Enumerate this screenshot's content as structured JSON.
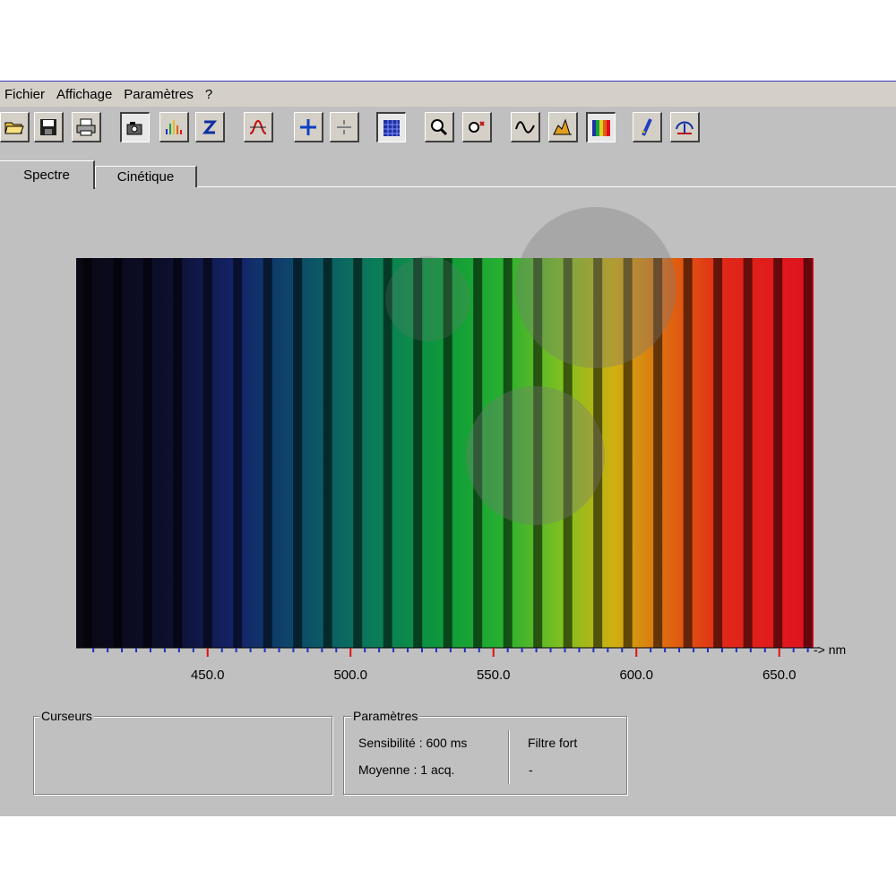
{
  "menu": {
    "items": [
      "Fichier",
      "Affichage",
      "Paramètres",
      "?"
    ]
  },
  "toolbar": {
    "buttons": [
      {
        "icon": "open-folder-icon",
        "pressed": false
      },
      {
        "icon": "save-icon",
        "pressed": false
      },
      {
        "icon": "print-icon",
        "pressed": false
      },
      {
        "icon": "camera-icon",
        "pressed": true
      },
      {
        "icon": "spectrum-bars-icon",
        "pressed": false
      },
      {
        "icon": "z-icon",
        "pressed": false
      },
      {
        "icon": "curve-fit-icon",
        "pressed": false
      },
      {
        "icon": "cursor-cross-icon",
        "pressed": false
      },
      {
        "icon": "divide-icon",
        "pressed": false
      },
      {
        "icon": "grid-icon",
        "pressed": true
      },
      {
        "icon": "zoom-icon",
        "pressed": false
      },
      {
        "icon": "zoom-reset-icon",
        "pressed": false
      },
      {
        "icon": "wave-icon",
        "pressed": false
      },
      {
        "icon": "spectrum-chart-icon",
        "pressed": false
      },
      {
        "icon": "rainbow-icon",
        "pressed": true
      },
      {
        "icon": "calibrate-icon",
        "pressed": false
      },
      {
        "icon": "balance-icon",
        "pressed": false
      }
    ]
  },
  "tabs": {
    "spectre": "Spectre",
    "cinetique": "Cinétique"
  },
  "spectrum": {
    "axis_unit": "-> nm",
    "ticks": [
      "450.0",
      "500.0",
      "550.0",
      "600.0",
      "650.0"
    ],
    "tick_values": [
      450,
      500,
      550,
      600,
      650
    ],
    "range_nm": [
      404,
      662
    ],
    "line_spacing_nm": 10.5,
    "colors": {
      "violet": "#100c22",
      "blue": "#12205a",
      "cyan": "#0a5a6a",
      "green": "#0e9a3a",
      "lime": "#6cc020",
      "yellow": "#d0b010",
      "orange": "#e06010",
      "red": "#e01020"
    }
  },
  "panels": {
    "curseurs": {
      "title": "Curseurs"
    },
    "parametres": {
      "title": "Paramètres",
      "sensibilite": "Sensibilité : 600 ms",
      "moyenne": "Moyenne : 1 acq.",
      "filtre": "Filtre fort",
      "filtre_value": "-"
    }
  }
}
